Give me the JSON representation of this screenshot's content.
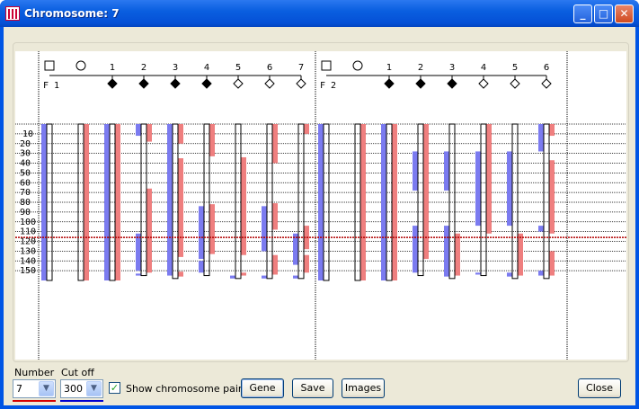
{
  "window": {
    "title": "Chromosome: 7"
  },
  "controls": {
    "number_label": "Number",
    "number_value": "7",
    "cutoff_label": "Cut off",
    "cutoff_value": "300",
    "show_pairs_label": "Show chromosome pairs",
    "show_pairs_checked": true,
    "gene_button": "Gene",
    "save_button": "Save",
    "images_button": "Images",
    "close_button": "Close"
  },
  "colors": {
    "maternal": "#7b7bf0",
    "paternal": "#ef7f7f",
    "cutoff_line": "#b00000",
    "number_underline": "#d40000",
    "cutoff_underline": "#0000d0"
  },
  "chart_data": {
    "type": "chromosome-segregation",
    "y_ticks": [
      10,
      20,
      30,
      40,
      50,
      60,
      70,
      80,
      90,
      100,
      110,
      120,
      130,
      140,
      150
    ],
    "y_range": [
      0,
      160
    ],
    "threshold_position": 116,
    "families": [
      {
        "label": "F1",
        "members": [
          {
            "label": "",
            "symbol": "square",
            "blue": [
              [
                0,
                160
              ]
            ],
            "red": [],
            "white": [
              [
                0,
                160
              ]
            ]
          },
          {
            "label": "",
            "symbol": "circle",
            "blue": [],
            "red": [
              [
                0,
                160
              ]
            ],
            "white": [
              [
                0,
                160
              ]
            ]
          },
          {
            "label": "1",
            "symbol": "filled-diamond",
            "blue": [
              [
                0,
                160
              ]
            ],
            "red": [
              [
                0,
                160
              ]
            ],
            "white": [
              [
                0,
                160
              ]
            ]
          },
          {
            "label": "2",
            "symbol": "filled-diamond",
            "blue": [
              [
                0,
                12
              ],
              [
                112,
                150
              ],
              [
                153,
                155
              ]
            ],
            "red": [
              [
                0,
                18
              ],
              [
                66,
                152
              ]
            ],
            "white": [
              [
                0,
                155
              ]
            ]
          },
          {
            "label": "3",
            "symbol": "filled-diamond",
            "blue": [
              [
                0,
                155
              ]
            ],
            "red": [
              [
                0,
                12
              ],
              [
                8,
                20
              ],
              [
                35,
                136
              ],
              [
                151,
                156
              ]
            ],
            "white": [
              [
                0,
                158
              ]
            ]
          },
          {
            "label": "4",
            "symbol": "filled-diamond",
            "blue": [
              [
                84,
                138
              ],
              [
                140,
                152
              ]
            ],
            "red": [
              [
                0,
                8
              ],
              [
                0,
                33
              ],
              [
                82,
                133
              ]
            ],
            "white": [
              [
                0,
                155
              ]
            ]
          },
          {
            "label": "5",
            "symbol": "empty-diamond",
            "blue": [
              [
                155,
                158
              ]
            ],
            "red": [
              [
                34,
                134
              ],
              [
                152,
                155
              ]
            ],
            "white": [
              [
                0,
                158
              ]
            ]
          },
          {
            "label": "6",
            "symbol": "empty-diamond",
            "blue": [
              [
                84,
                130
              ],
              [
                155,
                158
              ]
            ],
            "red": [
              [
                0,
                40
              ],
              [
                81,
                108
              ],
              [
                134,
                154
              ]
            ],
            "white": [
              [
                0,
                158
              ]
            ]
          },
          {
            "label": "7",
            "symbol": "empty-diamond",
            "blue": [
              [
                112,
                144
              ],
              [
                155,
                158
              ]
            ],
            "red": [
              [
                0,
                10
              ],
              [
                104,
                128
              ],
              [
                134,
                152
              ]
            ],
            "white": [
              [
                0,
                158
              ]
            ]
          }
        ]
      },
      {
        "label": "F2",
        "members": [
          {
            "label": "",
            "symbol": "square",
            "blue": [
              [
                0,
                160
              ]
            ],
            "red": [],
            "white": [
              [
                0,
                160
              ]
            ]
          },
          {
            "label": "",
            "symbol": "circle",
            "blue": [],
            "red": [
              [
                0,
                160
              ]
            ],
            "white": [
              [
                0,
                160
              ]
            ]
          },
          {
            "label": "1",
            "symbol": "filled-diamond",
            "blue": [
              [
                0,
                160
              ]
            ],
            "red": [
              [
                0,
                160
              ]
            ],
            "white": [
              [
                0,
                160
              ]
            ]
          },
          {
            "label": "2",
            "symbol": "filled-diamond",
            "blue": [
              [
                28,
                68
              ],
              [
                104,
                152
              ]
            ],
            "red": [
              [
                0,
                138
              ]
            ],
            "white": [
              [
                0,
                155
              ]
            ]
          },
          {
            "label": "3",
            "symbol": "filled-diamond",
            "blue": [
              [
                28,
                68
              ],
              [
                104,
                156
              ]
            ],
            "red": [
              [
                112,
                155
              ]
            ],
            "white": [
              [
                0,
                158
              ]
            ]
          },
          {
            "label": "4",
            "symbol": "empty-diamond",
            "blue": [
              [
                28,
                104
              ],
              [
                152,
                154
              ]
            ],
            "red": [
              [
                0,
                112
              ]
            ],
            "white": [
              [
                0,
                155
              ]
            ]
          },
          {
            "label": "5",
            "symbol": "empty-diamond",
            "blue": [
              [
                28,
                104
              ],
              [
                152,
                156
              ]
            ],
            "red": [
              [
                112,
                155
              ]
            ],
            "white": [
              [
                0,
                158
              ]
            ]
          },
          {
            "label": "6",
            "symbol": "empty-diamond",
            "blue": [
              [
                0,
                28
              ],
              [
                104,
                110
              ],
              [
                150,
                155
              ]
            ],
            "red": [
              [
                0,
                12
              ],
              [
                37,
                112
              ],
              [
                130,
                155
              ]
            ],
            "white": [
              [
                0,
                158
              ]
            ]
          }
        ]
      }
    ]
  }
}
